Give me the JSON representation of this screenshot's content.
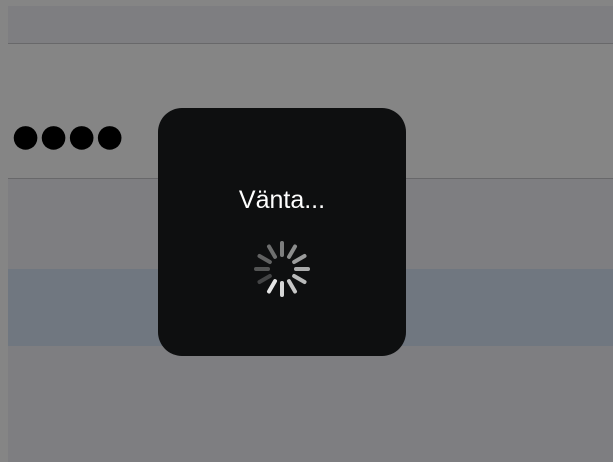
{
  "form": {
    "password_mask": "●●●●"
  },
  "hud": {
    "label": "Vänta...",
    "spinner_icon": "activity-spinner-icon"
  },
  "colors": {
    "overlay": "rgba(0,0,0,0.48)",
    "hud_background": "#0e0f10",
    "hud_text": "#ffffff",
    "highlight_band": "#d6e4f5"
  }
}
